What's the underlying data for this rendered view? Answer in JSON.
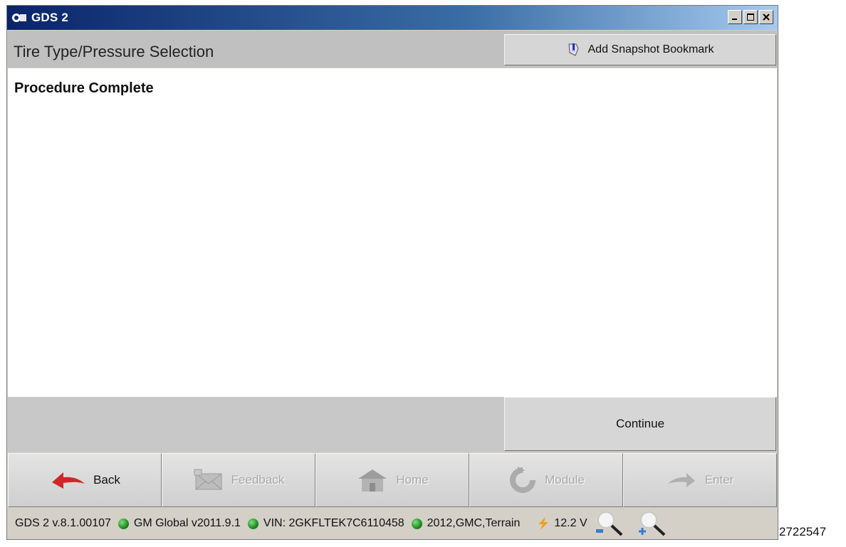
{
  "window": {
    "title": "GDS 2",
    "icon": "gds-app-icon"
  },
  "header": {
    "title": "Tire Type/Pressure Selection",
    "bookmark_label": "Add Snapshot Bookmark",
    "bookmark_icon": "bookmark-icon"
  },
  "content": {
    "status": "Procedure Complete"
  },
  "actions": {
    "continue_label": "Continue"
  },
  "nav": {
    "back": "Back",
    "feedback": "Feedback",
    "home": "Home",
    "module": "Module",
    "enter": "Enter"
  },
  "statusbar": {
    "version": "GDS 2 v.8.1.00107",
    "global": "GM Global v2011.9.1",
    "vin": "VIN: 2GKFLTEK7C6110458",
    "vehicle": "2012,GMC,Terrain",
    "voltage": "12.2 V"
  },
  "figure_id": "2722547",
  "colors": {
    "titlebar": "#0a246a",
    "status_dot": "#1f8a1f",
    "back_arrow": "#d0262a"
  }
}
